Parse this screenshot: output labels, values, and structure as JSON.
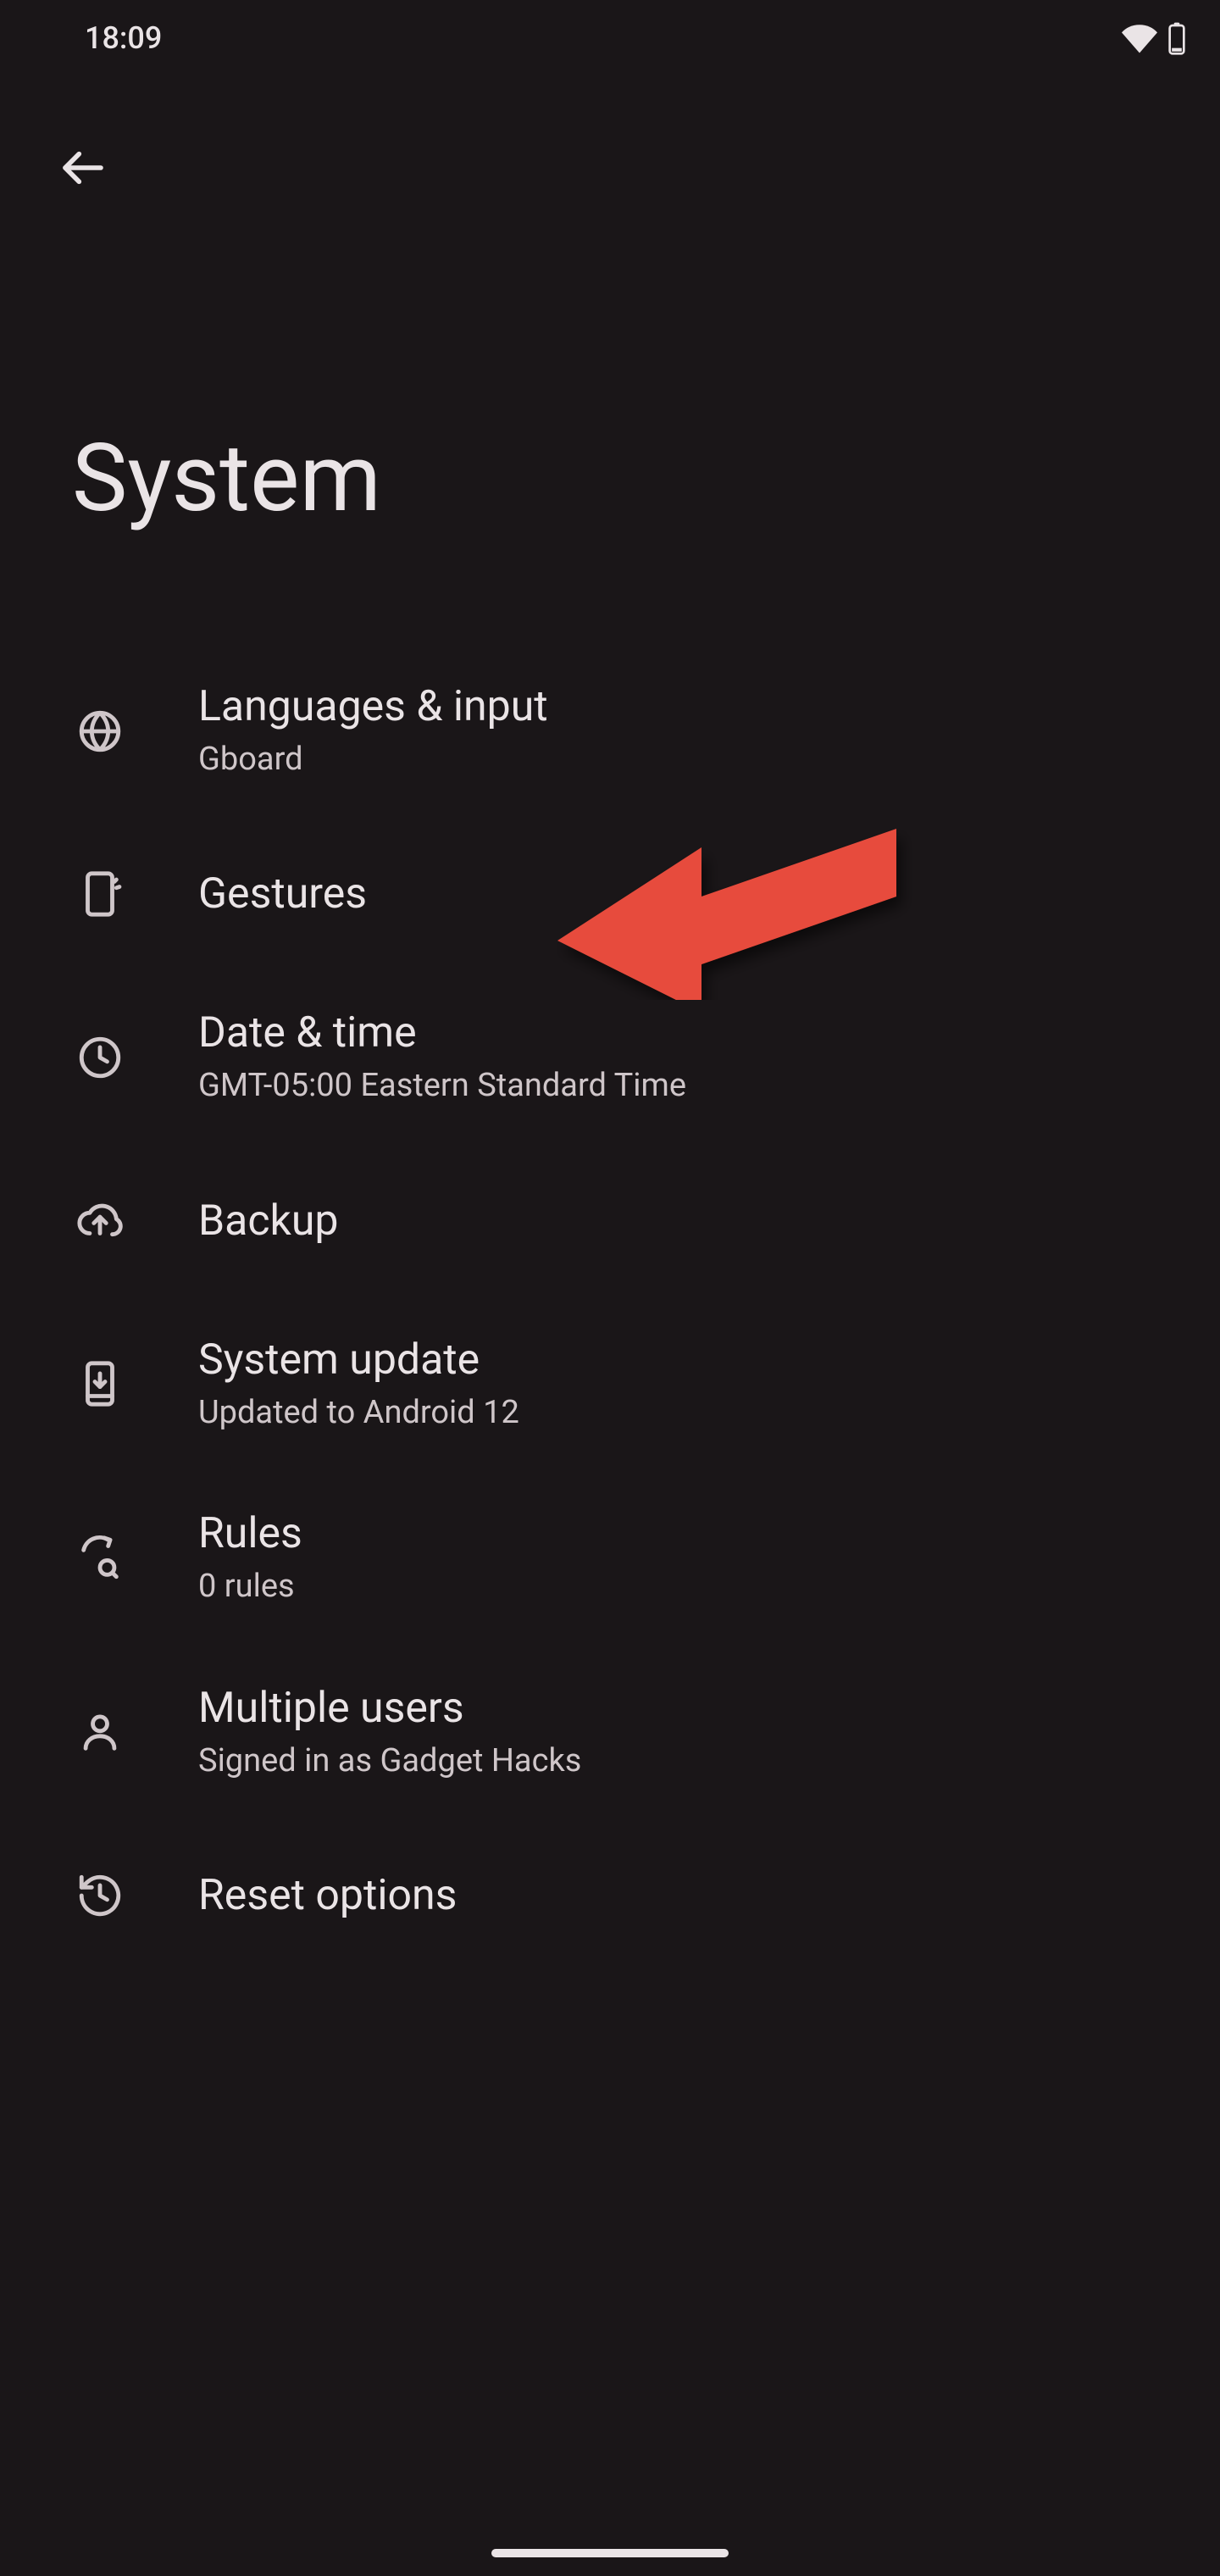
{
  "status": {
    "time": "18:09"
  },
  "page": {
    "title": "System"
  },
  "items": [
    {
      "icon": "globe",
      "title": "Languages & input",
      "subtitle": "Gboard"
    },
    {
      "icon": "gesture",
      "title": "Gestures",
      "subtitle": ""
    },
    {
      "icon": "clock",
      "title": "Date & time",
      "subtitle": "GMT-05:00 Eastern Standard Time"
    },
    {
      "icon": "cloud-up",
      "title": "Backup",
      "subtitle": ""
    },
    {
      "icon": "phone-down",
      "title": "System update",
      "subtitle": "Updated to Android 12"
    },
    {
      "icon": "rules",
      "title": "Rules",
      "subtitle": "0 rules"
    },
    {
      "icon": "person",
      "title": "Multiple users",
      "subtitle": "Signed in as Gadget Hacks"
    },
    {
      "icon": "history",
      "title": "Reset options",
      "subtitle": ""
    }
  ],
  "annotation": {
    "target_index": 1,
    "color": "#e74c3c"
  }
}
